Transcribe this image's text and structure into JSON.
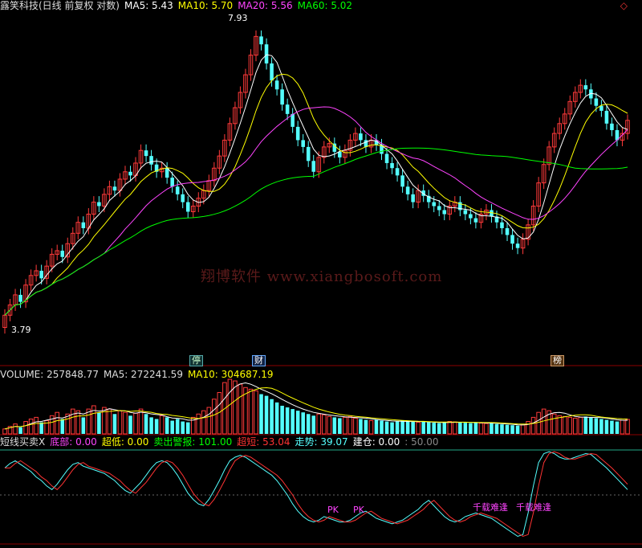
{
  "main_header": {
    "title": "露笑科技(日线 前复权 对数)",
    "ma5": "MA5: 5.43",
    "ma10": "MA10: 5.70",
    "ma20": "MA20: 5.56",
    "ma60": "MA60: 5.02"
  },
  "price_labels": {
    "high": "7.93",
    "low": "3.79"
  },
  "markers": {
    "ting": "停",
    "cai": "财",
    "bang": "榜"
  },
  "watermark": "翔博软件 www.xiangbosoft.com",
  "volume_header": {
    "volume": "VOLUME: 257848.77",
    "ma5": "MA5: 272241.59",
    "ma10": "MA10: 304687.19"
  },
  "indicator_header": {
    "name": "短线买卖X",
    "dibu": "底部: 0.00",
    "chaodi": "超低: 0.00",
    "maichu": "卖出警报: 101.00",
    "chaoduan": "超短: 53.04",
    "zoushi": "走势: 39.07",
    "jiancang": "建仓: 0.00",
    "level": ": 50.00"
  },
  "indicator_labels": {
    "pk1": "PK",
    "pk2": "PK",
    "qianzai1": "千载难逢",
    "qianzai2": "千载难逢"
  },
  "colors": {
    "up": "#ff3a3a",
    "down": "#54ffff",
    "ma5": "#ffffff",
    "ma10": "#ffff00",
    "ma20": "#ff44ff",
    "ma60": "#00ff00",
    "vol_ma5": "#ffffff",
    "vol_ma10": "#ffff00"
  },
  "chart_data": {
    "type": "candlestick",
    "ylim": [
      3.5,
      8.1
    ],
    "closes": [
      3.85,
      3.95,
      4.05,
      3.98,
      4.15,
      4.25,
      4.3,
      4.22,
      4.35,
      4.48,
      4.52,
      4.45,
      4.6,
      4.72,
      4.85,
      4.78,
      4.95,
      5.1,
      5.05,
      5.2,
      5.3,
      5.25,
      5.4,
      5.5,
      5.45,
      5.62,
      5.8,
      5.72,
      5.6,
      5.5,
      5.55,
      5.42,
      5.3,
      5.2,
      5.1,
      4.98,
      5.05,
      5.15,
      5.25,
      5.38,
      5.55,
      5.72,
      5.95,
      6.2,
      6.45,
      6.7,
      7.0,
      7.35,
      7.7,
      7.55,
      7.2,
      6.9,
      6.75,
      6.5,
      6.35,
      6.15,
      5.95,
      5.85,
      5.65,
      5.5,
      5.7,
      5.85,
      5.9,
      5.78,
      5.7,
      5.8,
      5.95,
      6.05,
      5.95,
      5.85,
      5.95,
      5.88,
      5.75,
      5.62,
      5.55,
      5.45,
      5.3,
      5.2,
      5.1,
      5.25,
      5.18,
      5.1,
      5.05,
      5.0,
      4.95,
      5.05,
      5.1,
      5.0,
      4.95,
      4.9,
      4.85,
      4.95,
      5.0,
      4.92,
      4.85,
      4.78,
      4.7,
      4.6,
      4.55,
      4.65,
      4.82,
      5.05,
      5.35,
      5.6,
      5.85,
      6.05,
      6.2,
      6.35,
      6.55,
      6.7,
      6.82,
      6.75,
      6.6,
      6.48,
      6.4,
      6.2,
      6.1,
      5.95,
      6.05,
      6.25
    ],
    "volume": [
      60000,
      90000,
      120000,
      80000,
      150000,
      180000,
      200000,
      140000,
      160000,
      220000,
      260000,
      180000,
      240000,
      300000,
      280000,
      200000,
      300000,
      340000,
      260000,
      320000,
      300000,
      240000,
      280000,
      260000,
      220000,
      250000,
      300000,
      240000,
      200000,
      180000,
      220000,
      200000,
      160000,
      180000,
      150000,
      140000,
      200000,
      240000,
      280000,
      320000,
      420000,
      500000,
      620000,
      660000,
      640000,
      600000,
      560000,
      540000,
      520000,
      480000,
      460000,
      420000,
      380000,
      340000,
      320000,
      300000,
      280000,
      260000,
      240000,
      220000,
      240000,
      230000,
      210000,
      200000,
      190000,
      200000,
      210000,
      190000,
      180000,
      170000,
      160000,
      170000,
      160000,
      150000,
      140000,
      150000,
      160000,
      150000,
      145000,
      140000,
      150000,
      140000,
      135000,
      130000,
      140000,
      150000,
      145000,
      140000,
      135000,
      130000,
      140000,
      130000,
      125000,
      130000,
      120000,
      115000,
      110000,
      105000,
      100000,
      110000,
      150000,
      200000,
      260000,
      300000,
      280000,
      240000,
      220000,
      210000,
      200000,
      190000,
      200000,
      210000,
      200000,
      190000,
      180000,
      170000,
      160000,
      150000,
      165000,
      175000
    ],
    "ma5": 5.43,
    "ma10": 5.7,
    "ma20": 5.56,
    "ma60": 5.02,
    "high": 7.93,
    "low": 3.79,
    "indicator": {
      "ylim": [
        0,
        100
      ],
      "midline": 50,
      "zoushi": [
        80,
        85,
        88,
        84,
        80,
        76,
        70,
        66,
        60,
        56,
        62,
        70,
        78,
        84,
        86,
        82,
        80,
        78,
        76,
        74,
        70,
        66,
        60,
        55,
        52,
        58,
        64,
        72,
        80,
        86,
        88,
        86,
        80,
        72,
        62,
        52,
        45,
        40,
        38,
        45,
        55,
        66,
        78,
        88,
        92,
        94,
        92,
        88,
        84,
        80,
        76,
        72,
        66,
        58,
        50,
        40,
        32,
        26,
        22,
        20,
        22,
        26,
        24,
        22,
        20,
        20,
        22,
        26,
        30,
        32,
        28,
        24,
        22,
        20,
        18,
        20,
        22,
        26,
        30,
        34,
        40,
        44,
        38,
        32,
        26,
        22,
        20,
        22,
        26,
        28,
        30,
        28,
        26,
        24,
        20,
        16,
        12,
        8,
        4,
        6,
        30,
        60,
        86,
        96,
        98,
        96,
        92,
        90,
        90,
        92,
        94,
        96,
        95,
        90,
        85,
        80,
        74,
        68,
        62,
        56
      ]
    }
  }
}
